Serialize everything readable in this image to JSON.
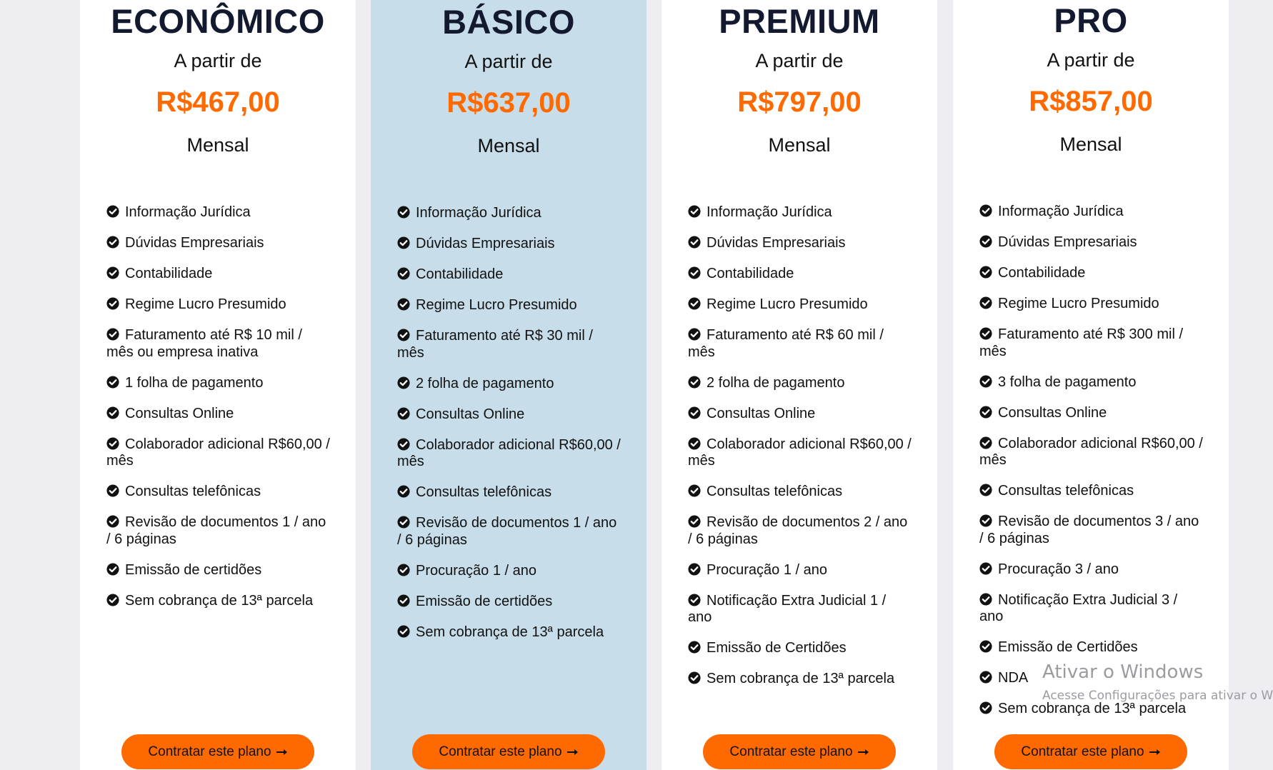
{
  "colors": {
    "page_bg": "#ededf2",
    "card_bg": "#ffffff",
    "highlight_bg": "#c7ddea",
    "price": "#ff6a00",
    "button": "#ff6a00",
    "title": "#13192f"
  },
  "plans": [
    {
      "title": "ECONÔMICO",
      "from_label": "A partir de",
      "price": "R$467,00",
      "period": "Mensal",
      "highlighted": false,
      "features": [
        "Informação Jurídica",
        "Dúvidas Empresariais",
        "Contabilidade",
        "Regime Lucro Presumido",
        "Faturamento até R$ 10 mil / mês ou empresa inativa",
        "1 folha de pagamento",
        "Consultas Online",
        "Colaborador adicional R$60,00 / mês",
        "Consultas telefônicas",
        "Revisão de documentos 1 / ano / 6 páginas",
        "Emissão de certidões",
        "Sem cobrança de 13ª parcela"
      ],
      "cta_label": "Contratar este plano",
      "cta_icon": "arrow-right-icon"
    },
    {
      "title": "BÁSICO",
      "from_label": "A partir de",
      "price": "R$637,00",
      "period": "Mensal",
      "highlighted": true,
      "features": [
        "Informação Jurídica",
        "Dúvidas Empresariais",
        "Contabilidade",
        "Regime Lucro Presumido",
        "Faturamento até R$ 30 mil / mês",
        "2 folha de pagamento",
        "Consultas Online",
        "Colaborador adicional R$60,00 / mês",
        "Consultas telefônicas",
        "Revisão de documentos 1 / ano / 6 páginas",
        "Procuração 1 / ano",
        "Emissão de certidões",
        "Sem cobrança de 13ª parcela"
      ],
      "cta_label": "Contratar este plano",
      "cta_icon": "arrow-right-icon"
    },
    {
      "title": "PREMIUM",
      "from_label": "A partir de",
      "price": "R$797,00",
      "period": "Mensal",
      "highlighted": false,
      "features": [
        "Informação Jurídica",
        "Dúvidas Empresariais",
        "Contabilidade",
        "Regime Lucro Presumido",
        "Faturamento até R$ 60 mil / mês",
        "2 folha de pagamento",
        "Consultas Online",
        "Colaborador adicional R$60,00 / mês",
        "Consultas telefônicas",
        "Revisão de documentos 2 / ano / 6 páginas",
        "Procuração 1 / ano",
        "Notificação Extra Judicial 1 / ano",
        "Emissão de Certidões",
        "Sem cobrança de 13ª parcela"
      ],
      "cta_label": "Contratar este plano",
      "cta_icon": "arrow-right-icon"
    },
    {
      "title": "PRO",
      "from_label": "A partir de",
      "price": "R$857,00",
      "period": "Mensal",
      "highlighted": false,
      "features": [
        "Informação Jurídica",
        "Dúvidas Empresariais",
        "Contabilidade",
        "Regime Lucro Presumido",
        "Faturamento até R$ 300 mil / mês",
        "3 folha de pagamento",
        "Consultas Online",
        "Colaborador adicional R$60,00 / mês",
        "Consultas telefônicas",
        "Revisão de documentos 3 / ano / 6 páginas",
        "Procuração 3 / ano",
        "Notificação Extra Judicial 3 / ano",
        "Emissão de Certidões",
        "NDA",
        "Sem cobrança de 13ª parcela"
      ],
      "cta_label": "Contratar este plano",
      "cta_icon": "arrow-right-icon"
    }
  ],
  "feature_icon": "check-circle-icon",
  "watermark": {
    "title": "Ativar o Windows",
    "subtitle": "Acesse Configurações para ativar o Windows."
  }
}
